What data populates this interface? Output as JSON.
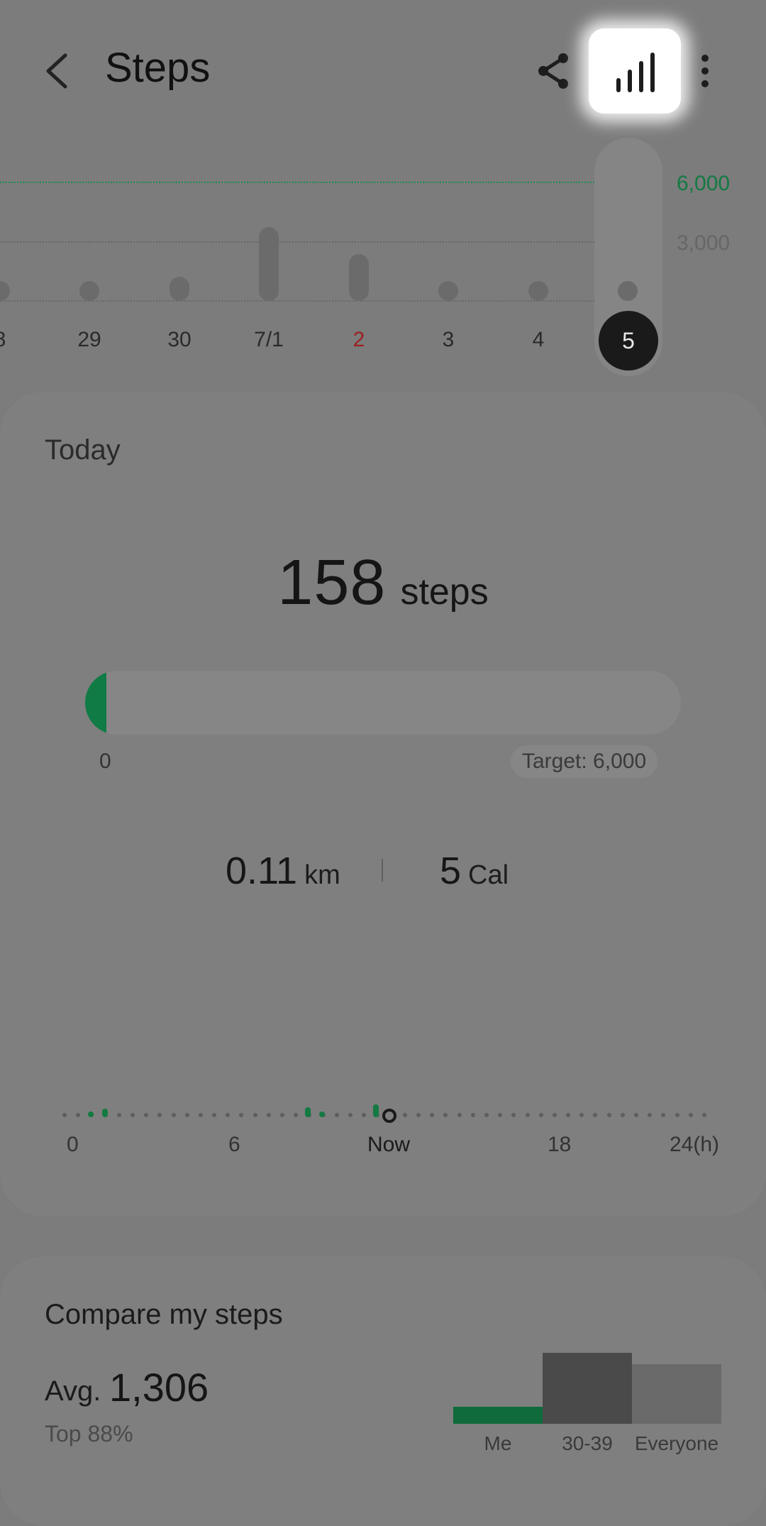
{
  "header": {
    "title": "Steps",
    "icons": [
      "back-arrow-icon",
      "share-icon",
      "bar-chart-icon",
      "more-vert-icon"
    ]
  },
  "weekly_chart": {
    "goal_label": "6,000",
    "mid_label": "3,000",
    "days": [
      "8",
      "29",
      "30",
      "7/1",
      "2",
      "3",
      "4",
      "5"
    ],
    "selected_day": "5",
    "sunday_day": "2",
    "colors": {
      "goal": "#137a42",
      "sunday": "#9b2020"
    }
  },
  "today": {
    "label": "Today",
    "steps_value": "158",
    "steps_unit": "steps",
    "progress_fraction": 0.026,
    "progress_start": "0",
    "target": "Target: 6,000",
    "distance_value": "0.11",
    "distance_unit": "km",
    "calories_value": "5",
    "calories_unit": "Cal",
    "timeline_labels": [
      "0",
      "6",
      "Now",
      "18",
      "24(h)"
    ]
  },
  "compare": {
    "title": "Compare my steps",
    "avg_prefix": "Avg.",
    "avg_value": "1,306",
    "top_percent": "Top 88%",
    "labels": [
      "Me",
      "30-39",
      "Everyone"
    ]
  }
}
